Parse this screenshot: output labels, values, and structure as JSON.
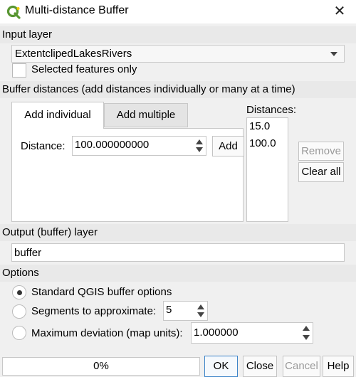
{
  "window": {
    "title": "Multi-distance Buffer"
  },
  "input": {
    "section_label": "Input layer",
    "layer_value": "ExtentclipedLakesRivers",
    "selected_only_label": "Selected features only"
  },
  "distances": {
    "section_label": "Buffer distances (add distances individually or many at a time)",
    "tabs": [
      {
        "label": "Add individual",
        "active": true
      },
      {
        "label": "Add multiple",
        "active": false
      }
    ],
    "distance_label": "Distance:",
    "distance_value": "100.000000000",
    "add_label": "Add",
    "list_label": "Distances:",
    "list": [
      "15.0",
      "100.0"
    ],
    "remove_label": "Remove",
    "clear_all_label": "Clear all"
  },
  "output": {
    "section_label": "Output (buffer) layer",
    "value": "buffer"
  },
  "options": {
    "section_label": "Options",
    "standard_label": "Standard QGIS buffer options",
    "segments_label": "Segments to approximate:",
    "segments_value": "5",
    "max_dev_label": "Maximum deviation (map units):",
    "max_dev_value": "1.000000",
    "selected": "standard"
  },
  "footer": {
    "progress": "0%",
    "ok_label": "OK",
    "close_label": "Close",
    "cancel_label": "Cancel",
    "help_label": "Help"
  },
  "colors": {
    "qgis_green": "#589632",
    "qgis_yellow": "#eec900"
  }
}
